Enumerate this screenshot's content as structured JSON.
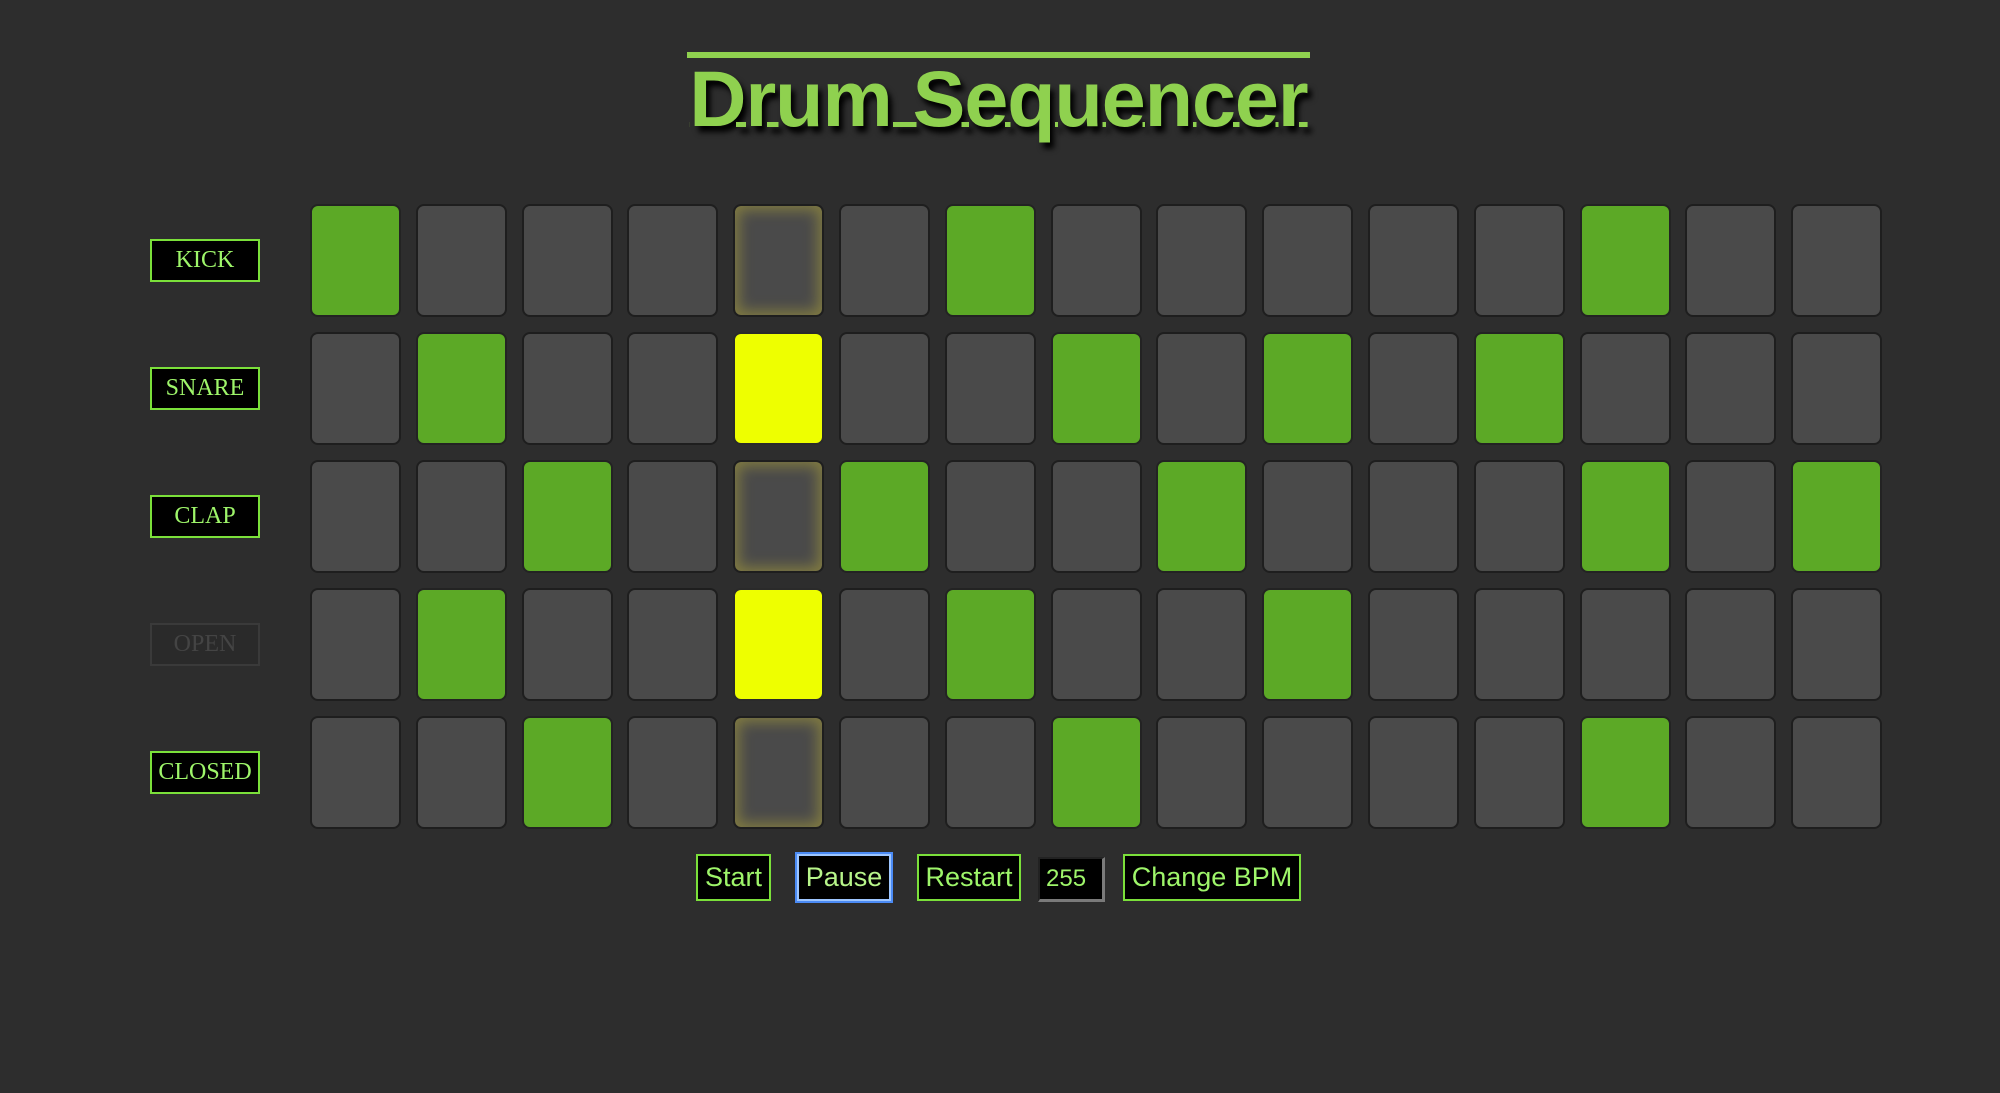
{
  "title": "Drum Sequencer",
  "colors": {
    "accent": "#8fd14f",
    "step_on": "#5ca926",
    "step_off": "#4a4a4a",
    "step_playing": "#eeff00",
    "background": "#2d2d2d"
  },
  "current_step": 4,
  "tracks": [
    {
      "label": "KICK",
      "muted": false,
      "steps": [
        1,
        0,
        0,
        0,
        0,
        0,
        1,
        0,
        0,
        0,
        0,
        0,
        1,
        0,
        0
      ]
    },
    {
      "label": "SNARE",
      "muted": false,
      "steps": [
        0,
        1,
        0,
        0,
        1,
        0,
        0,
        1,
        0,
        1,
        0,
        1,
        0,
        0,
        0
      ]
    },
    {
      "label": "CLAP",
      "muted": false,
      "steps": [
        0,
        0,
        1,
        0,
        0,
        1,
        0,
        0,
        1,
        0,
        0,
        0,
        1,
        0,
        1
      ]
    },
    {
      "label": "OPEN",
      "muted": true,
      "steps": [
        0,
        1,
        0,
        0,
        1,
        0,
        1,
        0,
        0,
        1,
        0,
        0,
        0,
        0,
        0
      ]
    },
    {
      "label": "CLOSED",
      "muted": false,
      "steps": [
        0,
        0,
        1,
        0,
        0,
        0,
        0,
        1,
        0,
        0,
        0,
        0,
        1,
        0,
        0
      ]
    }
  ],
  "controls": {
    "start_label": "Start",
    "pause_label": "Pause",
    "restart_label": "Restart",
    "bpm_value": "255",
    "change_bpm_label": "Change BPM"
  }
}
